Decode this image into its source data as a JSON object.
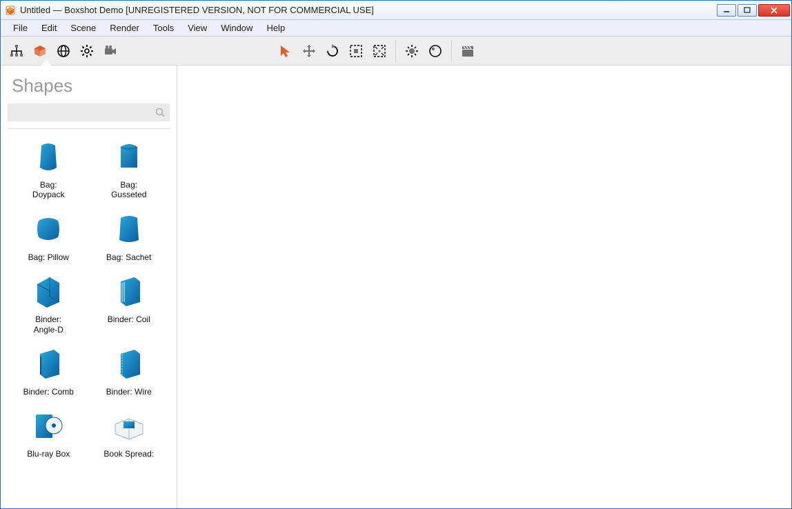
{
  "window": {
    "title": "Untitled — Boxshot Demo [UNREGISTERED VERSION, NOT FOR COMMERCIAL USE]"
  },
  "menu": {
    "items": [
      "File",
      "Edit",
      "Scene",
      "Render",
      "Tools",
      "View",
      "Window",
      "Help"
    ]
  },
  "toolbar": {
    "left": [
      "tree-icon",
      "box-icon",
      "globe-icon",
      "gear-icon",
      "camera-icon"
    ],
    "active_left_index": 1,
    "mid": [
      "arrow-icon",
      "move-icon",
      "rotate-icon",
      "fit-icon",
      "fit-all-icon"
    ],
    "active_mid_index": 0,
    "right1": [
      "light-icon",
      "sphere-icon"
    ],
    "right2": [
      "clapper-icon"
    ]
  },
  "sidebar": {
    "title": "Shapes",
    "search_placeholder": "",
    "shapes": [
      {
        "label": "Bag:\nDoypack",
        "icon": "bag-doypack"
      },
      {
        "label": "Bag:\nGusseted",
        "icon": "bag-gusseted"
      },
      {
        "label": "Bag: Pillow",
        "icon": "bag-pillow"
      },
      {
        "label": "Bag: Sachet",
        "icon": "bag-sachet"
      },
      {
        "label": "Binder:\nAngle-D",
        "icon": "binder-angled"
      },
      {
        "label": "Binder: Coil",
        "icon": "binder-coil"
      },
      {
        "label": "Binder: Comb",
        "icon": "binder-comb"
      },
      {
        "label": "Binder: Wire",
        "icon": "binder-wire"
      },
      {
        "label": "Blu-ray Box",
        "icon": "bluray-box"
      },
      {
        "label": "Book Spread:",
        "icon": "book-spread"
      }
    ]
  }
}
